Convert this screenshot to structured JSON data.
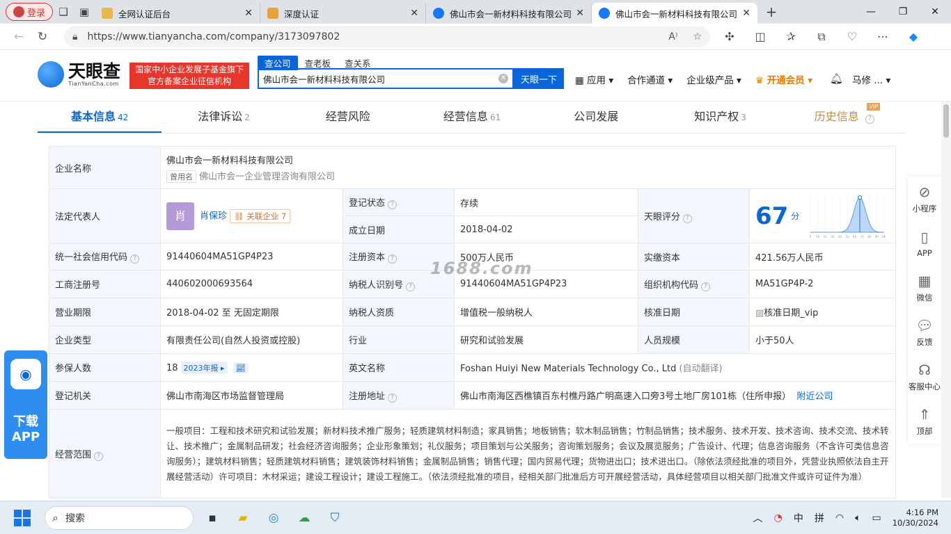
{
  "browser": {
    "profile_label": "登录",
    "tabs": [
      {
        "title": "全网认证后台",
        "active": false
      },
      {
        "title": "深度认证",
        "active": false
      },
      {
        "title": "佛山市会一新材料科技有限公司_",
        "active": false
      },
      {
        "title": "佛山市会一新材料科技有限公司 -",
        "active": true
      }
    ],
    "url": "https://www.tianyancha.com/company/3173097802"
  },
  "site": {
    "logo_name": "天眼查",
    "logo_sub": "TianYanCha.com",
    "slogan_line1": "国家中小企业发展子基金旗下",
    "slogan_line2": "官方备案企业征信机构",
    "search_tabs": [
      "查公司",
      "查老板",
      "查关系"
    ],
    "search_value": "佛山市会一新材料科技有限公司",
    "search_button": "天眼一下",
    "nav": [
      "应用",
      "合作通道",
      "企业级产品",
      "开通会员"
    ],
    "user_name": "马修 ..."
  },
  "content_tabs": [
    {
      "label": "基本信息",
      "count": "42"
    },
    {
      "label": "法律诉讼",
      "count": "2"
    },
    {
      "label": "经营风险",
      "count": ""
    },
    {
      "label": "经营信息",
      "count": "61"
    },
    {
      "label": "公司发展",
      "count": ""
    },
    {
      "label": "知识产权",
      "count": "3"
    },
    {
      "label": "历史信息",
      "count": ""
    }
  ],
  "vip_tag": "VIP",
  "company": {
    "k_name": "企业名称",
    "name": "佛山市会一新材料科技有限公司",
    "former_tag": "曾用名",
    "former_name": "佛山市会一企业管理咨询有限公司",
    "k_legal": "法定代表人",
    "legal_avatar": "肖",
    "legal_name": "肖保珍",
    "related_label": "关联企业",
    "related_count": "7",
    "k_status": "登记状态",
    "status": "存续",
    "k_found": "成立日期",
    "found_date": "2018-04-02",
    "k_score": "天眼评分",
    "score": "67",
    "score_unit": "分",
    "k_credit": "统一社会信用代码",
    "credit_code": "91440604MA51GP4P23",
    "k_capital": "注册资本",
    "capital": "500万人民币",
    "k_paid": "实缴资本",
    "paid_capital": "421.56万人民币",
    "k_reg_no": "工商注册号",
    "reg_no": "440602000693564",
    "k_tax_id": "纳税人识别号",
    "tax_id": "91440604MA51GP4P23",
    "k_org_code": "组织机构代码",
    "org_code": "MA51GP4P-2",
    "k_term": "营业期限",
    "term": "2018-04-02 至 无固定期限",
    "k_tax_qual": "纳税人资质",
    "tax_qual": "增值税一般纳税人",
    "k_approve": "核准日期",
    "approve": "核准日期_vip",
    "k_type": "企业类型",
    "type": "有限责任公司(自然人投资或控股)",
    "k_industry": "行业",
    "industry": "研究和试验发展",
    "k_staff": "人员规模",
    "staff": "小于50人",
    "k_insured": "参保人数",
    "insured": "18",
    "report_badge": "2023年报",
    "k_en_name": "英文名称",
    "en_name": "Foshan Huiyi New Materials Technology Co., Ltd",
    "auto_translate": "(自动翻译)",
    "k_authority": "登记机关",
    "authority": "佛山市南海区市场监督管理局",
    "k_address": "注册地址",
    "address": "佛山市南海区西樵镇百东村樵丹路广明高速入口旁3号土地厂房101栋（住所申报）",
    "nearby": "附近公司",
    "k_scope": "经营范围",
    "scope": "一般项目：工程和技术研究和试验发展；新材料技术推广服务；轻质建筑材料制造；家具销售；地板销售；软木制品销售；竹制品销售；技术服务、技术开发、技术咨询、技术交流、技术转让、技术推广；金属制品研发；社会经济咨询服务；企业形象策划；礼仪服务；项目策划与公关服务；咨询策划服务；会议及展览服务；广告设计、代理；信息咨询服务（不含许可类信息咨询服务）；建筑材料销售；轻质建筑材料销售；建筑装饰材料销售；金属制品销售；销售代理；国内贸易代理；货物进出口；技术进出口。（除依法须经批准的项目外，凭营业执照依法自主开展经营活动）许可项目：木材采运；建设工程设计；建设工程施工。（依法须经批准的项目，经相关部门批准后方可开展经营活动，具体经营项目以相关部门批准文件或许可证件为准）"
  },
  "score_chart": {
    "type": "area",
    "x_ticks": [
      "0",
      "10",
      "20",
      "30",
      "40",
      "50",
      "60",
      "70",
      "80",
      "90",
      "100"
    ],
    "marker_value": 67
  },
  "watermark": "1688.com",
  "right_sidebar": [
    "小程序",
    "APP",
    "微信",
    "反馈",
    "客服中心",
    "顶部"
  ],
  "download_app": {
    "line1": "下载",
    "line2": "APP"
  },
  "taskbar": {
    "search_label": "搜索",
    "ime1": "中",
    "ime2": "拼",
    "time": "4:16 PM",
    "date": "10/30/2024"
  }
}
